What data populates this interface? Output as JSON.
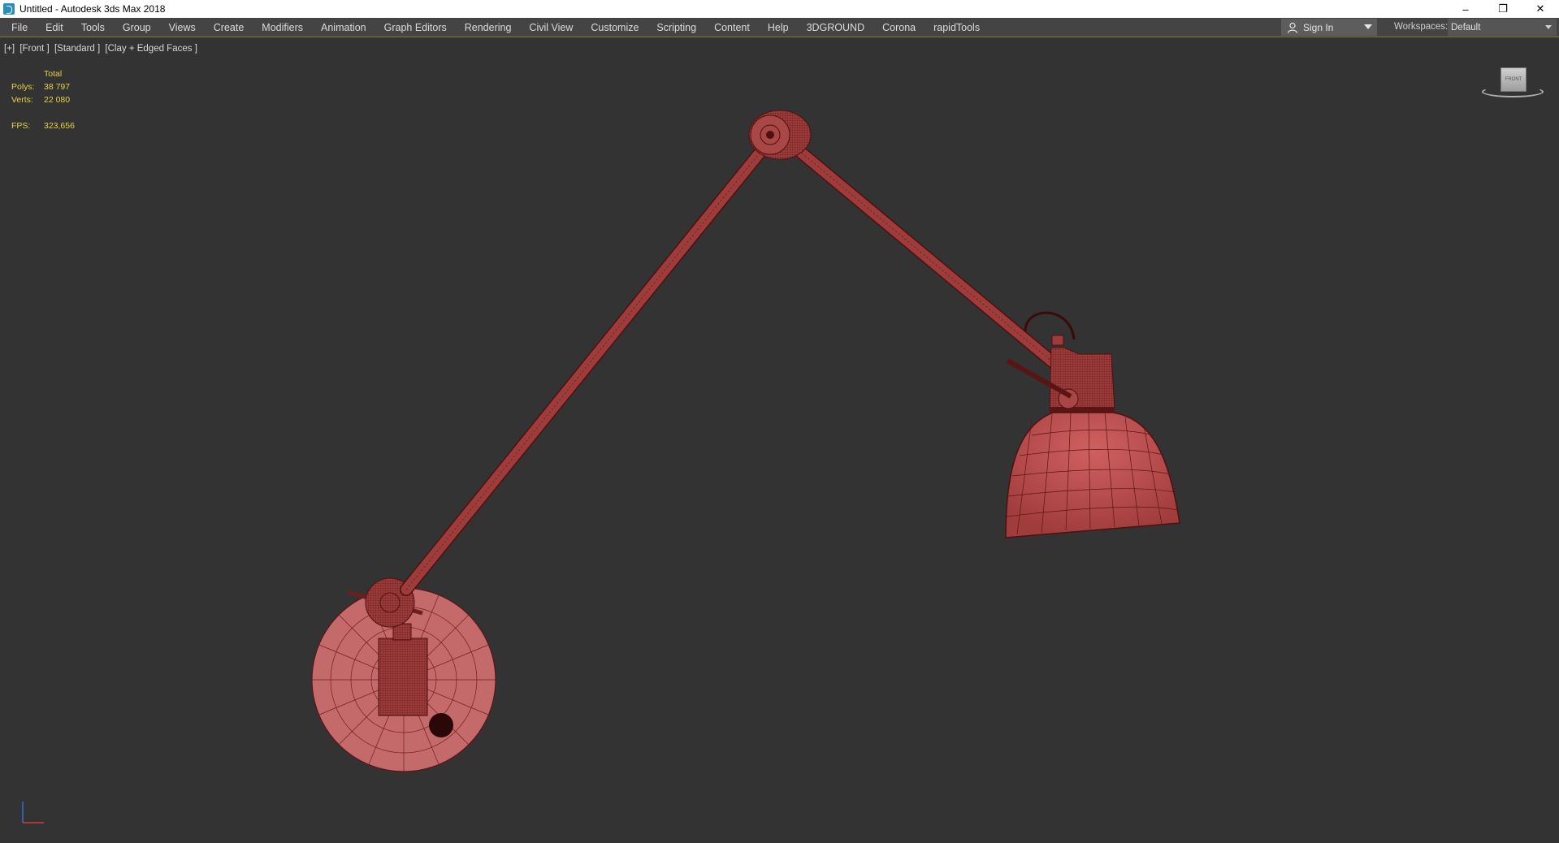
{
  "window": {
    "title": "Untitled - Autodesk 3ds Max 2018",
    "controls": [
      "–",
      "❐",
      "✕"
    ]
  },
  "menu": [
    "File",
    "Edit",
    "Tools",
    "Group",
    "Views",
    "Create",
    "Modifiers",
    "Animation",
    "Graph Editors",
    "Rendering",
    "Civil View",
    "Customize",
    "Scripting",
    "Content",
    "Help",
    "3DGROUND",
    "Corona",
    "rapidTools"
  ],
  "account": {
    "sign_in": "Sign In"
  },
  "workspaces": {
    "label": "Workspaces:",
    "value": "Default"
  },
  "viewport": {
    "label_parts": [
      "[+]",
      "[Front ]",
      "[Standard ]",
      "[Clay + Edged Faces ]"
    ],
    "stats": {
      "header": "Total",
      "polys_label": "Polys:",
      "polys": "38 797",
      "verts_label": "Verts:",
      "verts": "22 080",
      "fps_label": "FPS:",
      "fps": "323,656"
    },
    "viewcube_face": "FRONT"
  },
  "colors": {
    "viewport_bg": "#333333",
    "menubar_bg": "#444444",
    "stats_text": "#e8d047",
    "model_fill": "#b24a4a",
    "model_wire": "#5a1414"
  }
}
